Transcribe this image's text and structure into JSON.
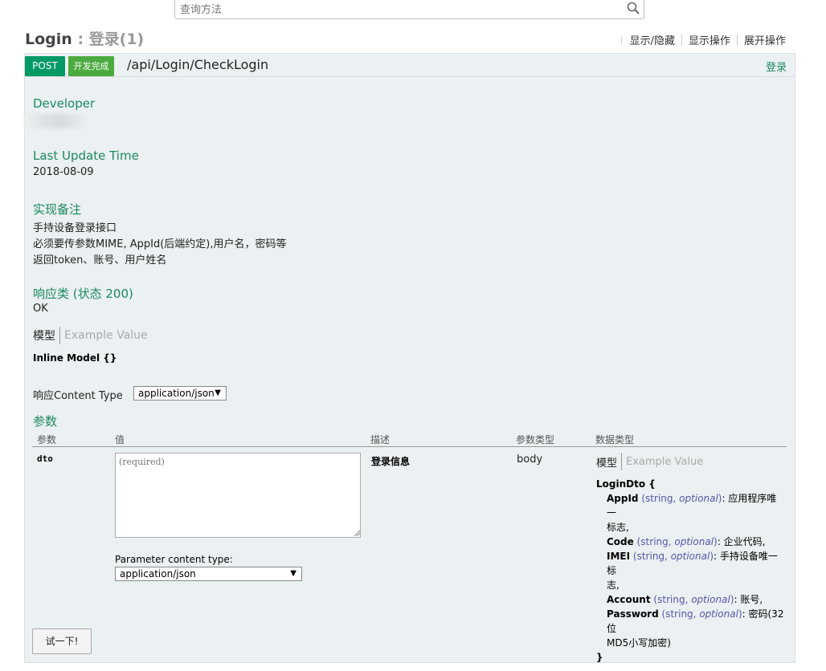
{
  "search": {
    "placeholder": "查询方法"
  },
  "header": {
    "title": "Login",
    "subtitle": ": 登录(1)",
    "ops": [
      "显示/隐藏",
      "显示操作",
      "展开操作"
    ]
  },
  "operation": {
    "method": "POST",
    "status_badge": "开发完成",
    "path": "/api/Login/CheckLogin",
    "summary": "登录"
  },
  "developer": {
    "heading": "Developer"
  },
  "last_update": {
    "heading": "Last Update Time",
    "value": "2018-08-09"
  },
  "notes": {
    "heading": "实现备注",
    "lines": [
      "手持设备登录接口",
      "必须要传参数MIME, AppId(后端约定),用户名，密码等",
      "返回token、账号、用户姓名"
    ]
  },
  "response": {
    "heading": "响应类 (状态 200)",
    "status_text": "OK",
    "tab_model": "模型",
    "tab_example": "Example Value",
    "model_text": "Inline Model {}",
    "content_type_label": "响应Content Type",
    "content_type_value": "application/json"
  },
  "params": {
    "heading": "参数",
    "columns": [
      "参数",
      "值",
      "描述",
      "参数类型",
      "数据类型"
    ],
    "rows": [
      {
        "name": "dto",
        "placeholder": "(required)",
        "description": "登录信息",
        "param_type": "body",
        "content_type_label": "Parameter content type:",
        "content_type_value": "application/json",
        "tab_model": "模型",
        "tab_example": "Example Value",
        "model": {
          "name": "LoginDto {",
          "close": "}",
          "fields": [
            {
              "name": "AppId",
              "type": "string",
              "opt": "optional",
              "desc": "应用程序唯一",
              "desc2": "标志,"
            },
            {
              "name": "Code",
              "type": "string",
              "opt": "optional",
              "desc": "企业代码,",
              "desc2": ""
            },
            {
              "name": "IMEI",
              "type": "string",
              "opt": "optional",
              "desc": "手持设备唯一标",
              "desc2": "志,"
            },
            {
              "name": "Account",
              "type": "string",
              "opt": "optional",
              "desc": "账号,",
              "desc2": ""
            },
            {
              "name": "Password",
              "type": "string",
              "opt": "optional",
              "desc": "密码(32位",
              "desc2": "MD5小写加密)"
            }
          ]
        }
      }
    ]
  },
  "try_button": "试一下!",
  "colors": {
    "accent": "#1b8a5e",
    "post": "#009a66",
    "done": "#4baa3f",
    "panel_bg": "#ebf0f2"
  },
  "icons": {
    "search": "search-icon",
    "resize": "resize-grip-icon",
    "dropdown": "dropdown-arrow-icon"
  }
}
